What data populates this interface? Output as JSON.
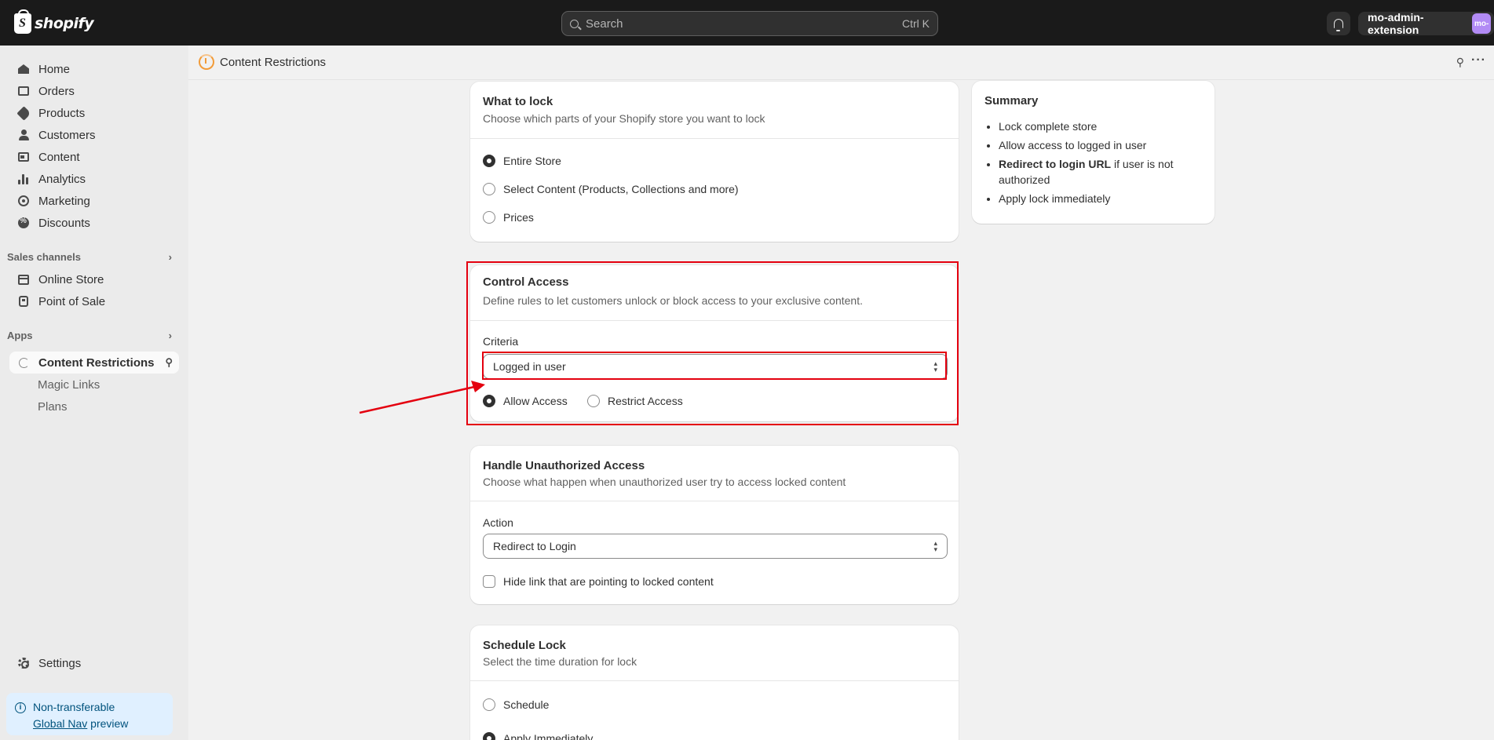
{
  "topbar": {
    "brand": "shopify",
    "search_placeholder": "Search",
    "search_shortcut": "Ctrl K",
    "account_name": "mo-admin-extension",
    "avatar_text": "mo-"
  },
  "sidebar": {
    "items": [
      {
        "label": "Home",
        "icon": "home-icon"
      },
      {
        "label": "Orders",
        "icon": "orders-icon"
      },
      {
        "label": "Products",
        "icon": "tag-icon"
      },
      {
        "label": "Customers",
        "icon": "person-icon"
      },
      {
        "label": "Content",
        "icon": "content-icon"
      },
      {
        "label": "Analytics",
        "icon": "bar-chart-icon"
      },
      {
        "label": "Marketing",
        "icon": "target-icon"
      },
      {
        "label": "Discounts",
        "icon": "discount-icon"
      }
    ],
    "sales_channels_heading": "Sales channels",
    "sales_channels": [
      {
        "label": "Online Store",
        "icon": "store-icon"
      },
      {
        "label": "Point of Sale",
        "icon": "pos-icon"
      }
    ],
    "apps_heading": "Apps",
    "apps": [
      {
        "label": "Content Restrictions",
        "icon": "app-icon"
      },
      {
        "label": "Magic Links"
      },
      {
        "label": "Plans"
      }
    ],
    "settings_label": "Settings",
    "notice": {
      "line1": "Non-transferable",
      "link": "Global Nav",
      "line2_suffix": " preview"
    }
  },
  "header": {
    "app_title": "Content Restrictions"
  },
  "what_to_lock": {
    "title": "What to lock",
    "description": "Choose which parts of your Shopify store you want to lock",
    "options": [
      {
        "label": "Entire Store",
        "selected": true
      },
      {
        "label": "Select Content (Products, Collections and more)",
        "selected": false
      },
      {
        "label": "Prices",
        "selected": false
      }
    ]
  },
  "control_access": {
    "title": "Control Access",
    "description": "Define rules to let customers unlock or block access to your exclusive content.",
    "criteria_label": "Criteria",
    "criteria_value": "Logged in user",
    "options": [
      {
        "label": "Allow Access",
        "selected": true
      },
      {
        "label": "Restrict Access",
        "selected": false
      }
    ]
  },
  "unauthorized": {
    "title": "Handle Unauthorized Access",
    "description": "Choose what happen when unauthorized user try to access locked content",
    "action_label": "Action",
    "action_value": "Redirect to Login",
    "checkbox_label": "Hide link that are pointing to locked content"
  },
  "schedule": {
    "title": "Schedule Lock",
    "description": "Select the time duration for lock",
    "options": [
      {
        "label": "Schedule",
        "selected": false
      },
      {
        "label": "Apply Immediately",
        "selected": true
      }
    ]
  },
  "summary": {
    "title": "Summary",
    "items": [
      "Lock complete store",
      "Allow access to logged in user",
      "if user is not authorized",
      "Apply lock immediately"
    ],
    "bold_part": "Redirect to login URL"
  },
  "colors": {
    "annotation_red": "#e4000f",
    "topbar": "#1a1a1a",
    "accent_app": "#f29b38"
  }
}
